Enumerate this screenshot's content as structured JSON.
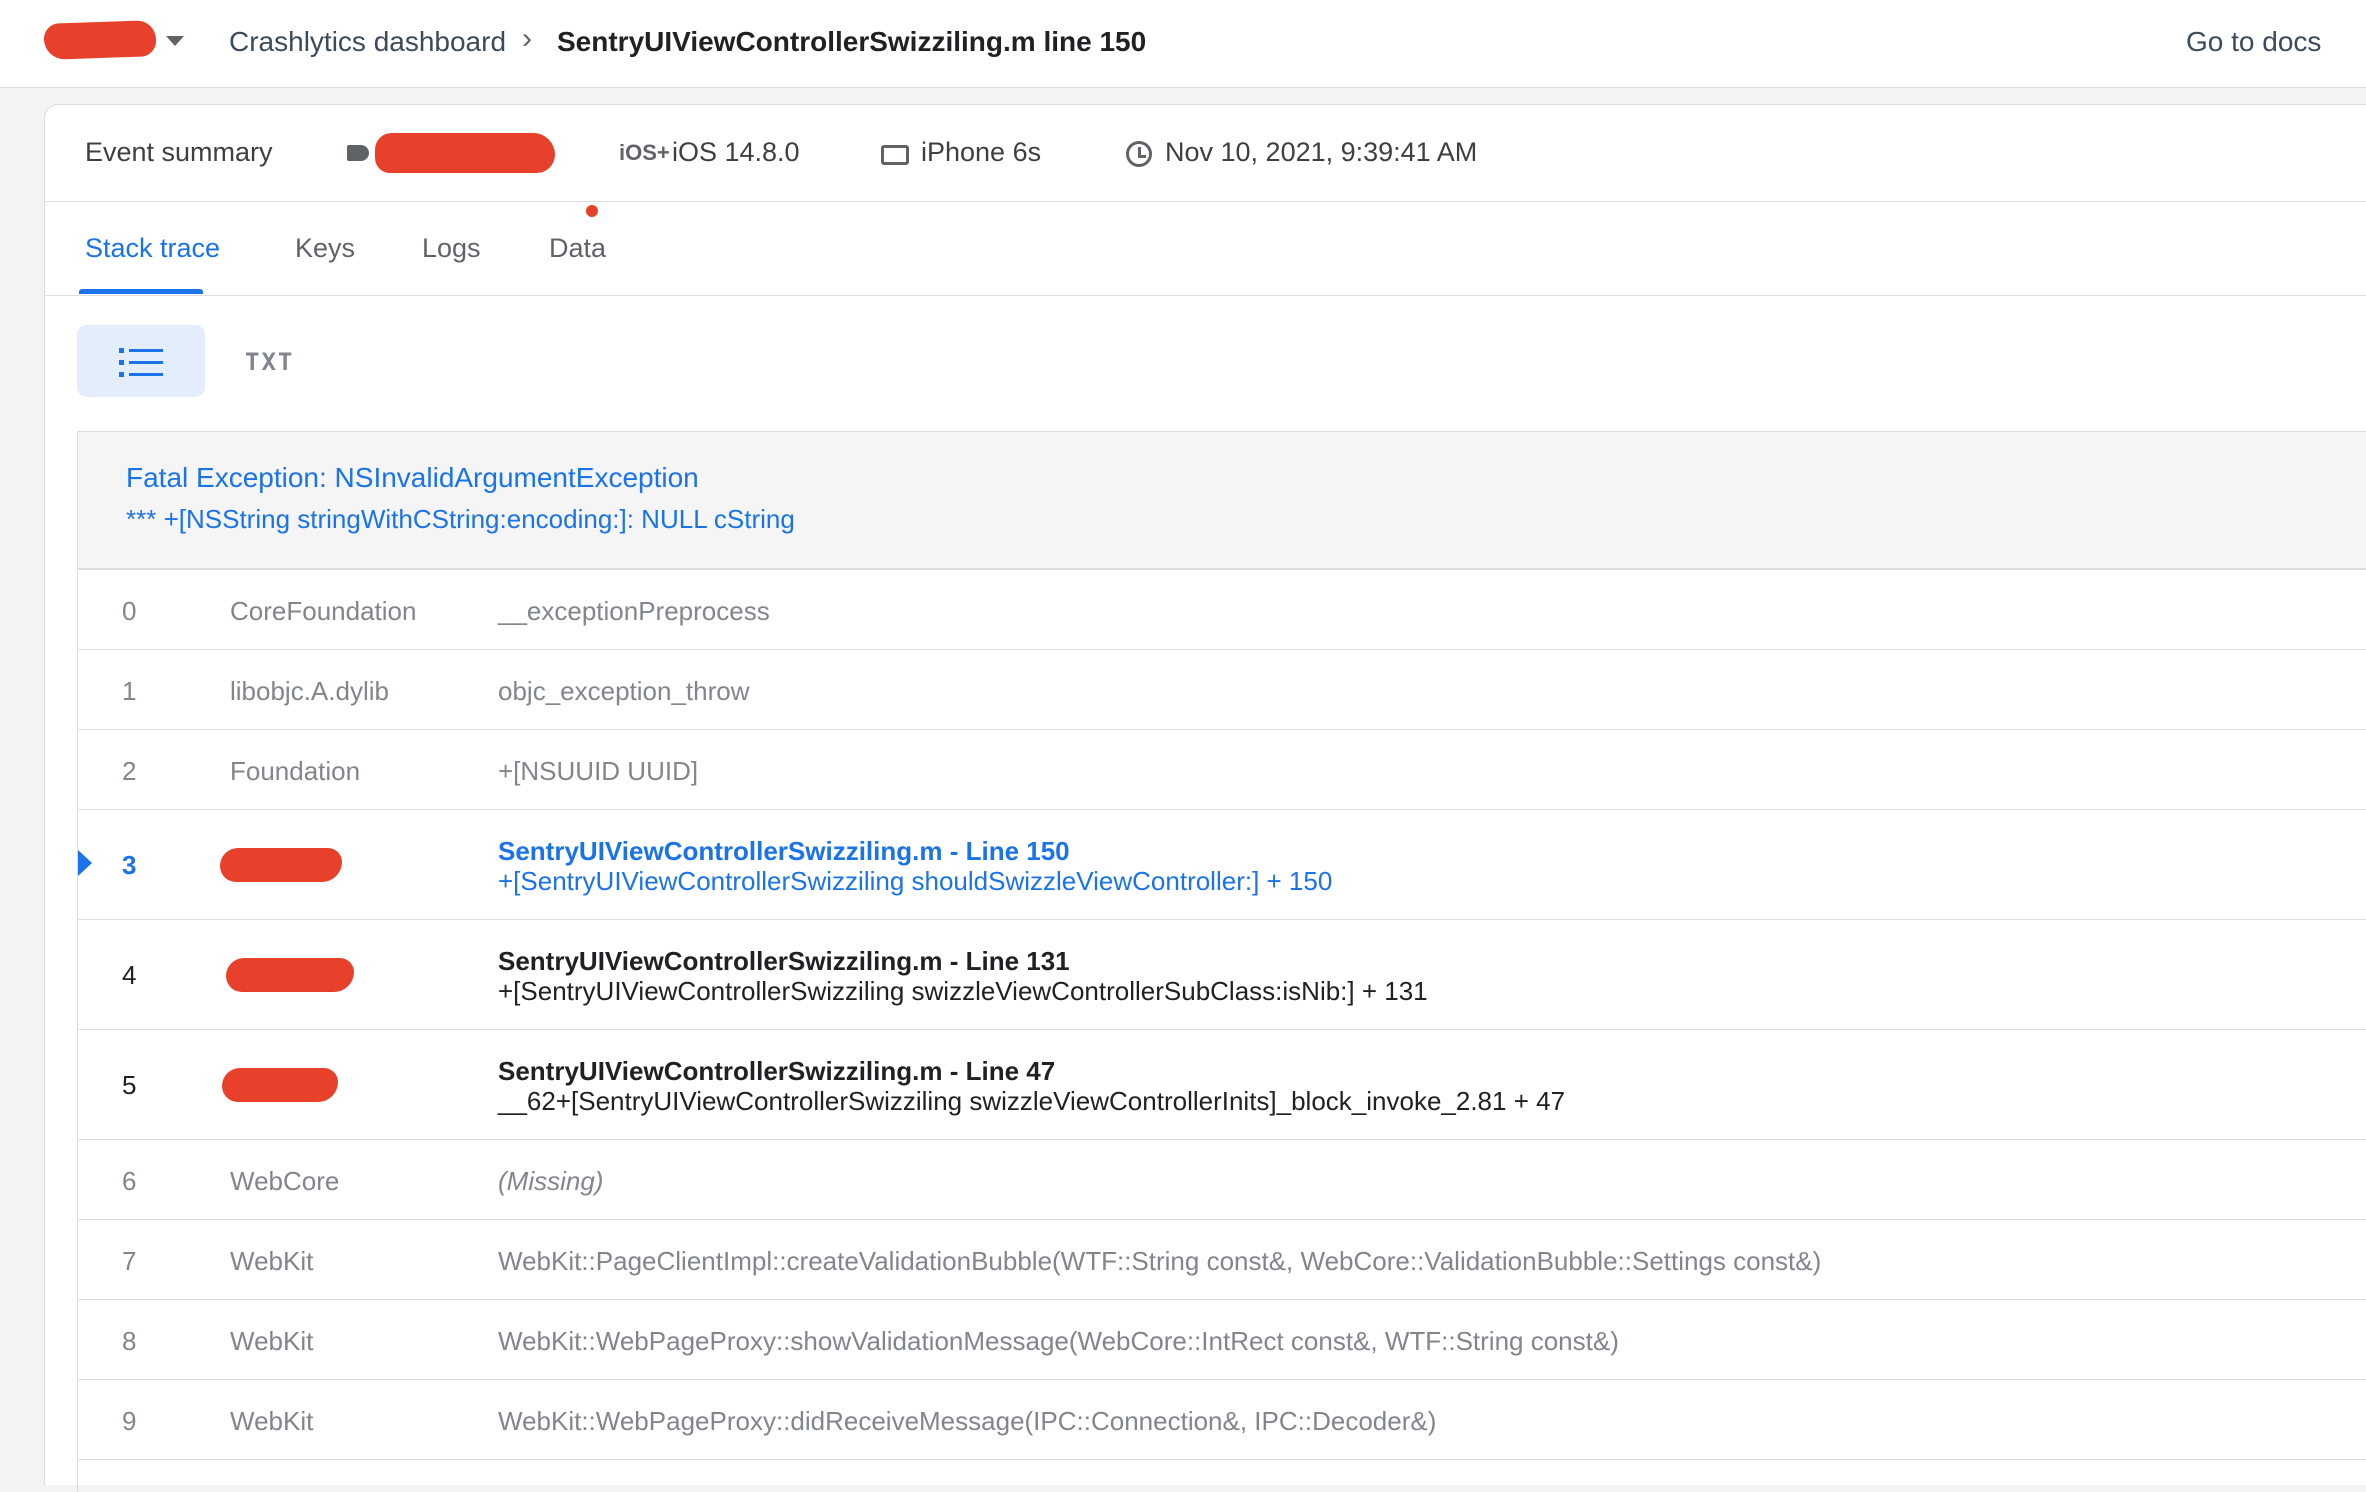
{
  "topbar": {
    "breadcrumb_root": "Crashlytics dashboard",
    "breadcrumb_sep": "›",
    "breadcrumb_current": "SentryUIViewControllerSwizziling.m line 150",
    "docs_link": "Go to docs"
  },
  "summary": {
    "label": "Event summary",
    "os_icon": "iOS+",
    "os": "iOS 14.8.0",
    "device": "iPhone 6s",
    "date": "Nov 10, 2021, 9:39:41 AM"
  },
  "tabs": [
    {
      "label": "Stack trace"
    },
    {
      "label": "Keys"
    },
    {
      "label": "Logs"
    },
    {
      "label": "Data"
    }
  ],
  "view_toggle": {
    "txt_label": "TXT"
  },
  "exception": {
    "title": "Fatal Exception: NSInvalidArgumentException",
    "message": "*** +[NSString stringWithCString:encoding:]: NULL cString"
  },
  "frames": [
    {
      "num": "0",
      "lib": "CoreFoundation",
      "symbol": "__exceptionPreprocess"
    },
    {
      "num": "1",
      "lib": "libobjc.A.dylib",
      "symbol": "objc_exception_throw"
    },
    {
      "num": "2",
      "lib": "Foundation",
      "symbol": "+[NSUUID UUID]"
    },
    {
      "num": "3",
      "file": "SentryUIViewControllerSwizziling.m - Line 150",
      "func": "+[SentryUIViewControllerSwizziling shouldSwizzleViewController:] + 150"
    },
    {
      "num": "4",
      "file": "SentryUIViewControllerSwizziling.m - Line 131",
      "func": "+[SentryUIViewControllerSwizziling swizzleViewControllerSubClass:isNib:] + 131"
    },
    {
      "num": "5",
      "file": "SentryUIViewControllerSwizziling.m - Line 47",
      "func": "__62+[SentryUIViewControllerSwizziling swizzleViewControllerInits]_block_invoke_2.81 + 47"
    },
    {
      "num": "6",
      "lib": "WebCore",
      "symbol": "(Missing)"
    },
    {
      "num": "7",
      "lib": "WebKit",
      "symbol": "WebKit::PageClientImpl::createValidationBubble(WTF::String const&, WebCore::ValidationBubble::Settings const&)"
    },
    {
      "num": "8",
      "lib": "WebKit",
      "symbol": "WebKit::WebPageProxy::showValidationMessage(WebCore::IntRect const&, WTF::String const&)"
    },
    {
      "num": "9",
      "lib": "WebKit",
      "symbol": "WebKit::WebPageProxy::didReceiveMessage(IPC::Connection&, IPC::Decoder&)"
    }
  ]
}
